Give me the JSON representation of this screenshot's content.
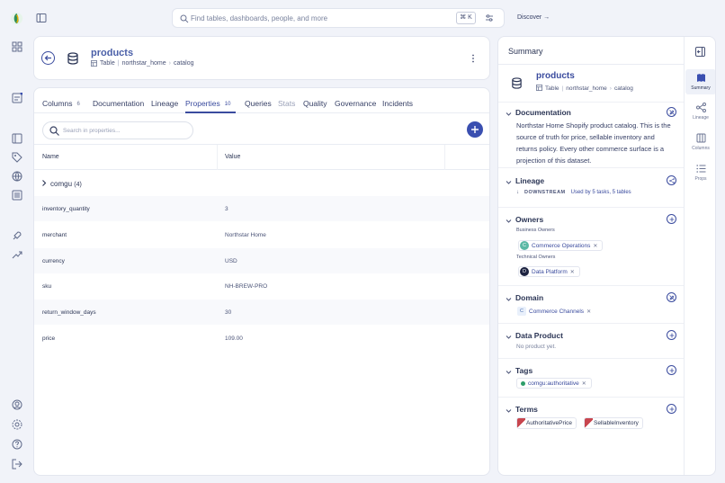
{
  "topbar": {
    "search_placeholder": "Find tables, dashboards, people, and more",
    "shortcut": "⌘ K",
    "discover_label": "Discover →"
  },
  "entity": {
    "name": "products",
    "type": "Table",
    "breadcrumb": [
      "northstar_home",
      "catalog"
    ]
  },
  "tabs": [
    {
      "label": "Columns",
      "count": "6"
    },
    {
      "label": "Documentation",
      "count": ""
    },
    {
      "label": "Lineage",
      "count": ""
    },
    {
      "label": "Properties",
      "count": "10"
    },
    {
      "label": "Queries",
      "count": ""
    },
    {
      "label": "Stats",
      "count": ""
    },
    {
      "label": "Quality",
      "count": ""
    },
    {
      "label": "Governance",
      "count": ""
    },
    {
      "label": "Incidents",
      "count": ""
    }
  ],
  "properties": {
    "search_placeholder": "Search in properties...",
    "col_name": "Name",
    "col_value": "Value",
    "group": {
      "label": "comgu",
      "count": "(4)"
    },
    "rows": [
      {
        "name": "inventory_quantity",
        "value": "3"
      },
      {
        "name": "merchant",
        "value": "Northstar Home"
      },
      {
        "name": "currency",
        "value": "USD"
      },
      {
        "name": "sku",
        "value": "NH-BREW-PRO"
      },
      {
        "name": "return_window_days",
        "value": "30"
      },
      {
        "name": "price",
        "value": "109.00"
      }
    ]
  },
  "summary": {
    "title": "Summary",
    "side_tabs": [
      "Summary",
      "Lineage",
      "Columns",
      "Props"
    ],
    "documentation": {
      "heading": "Documentation",
      "text": "Northstar Home Shopify product catalog. This is the source of truth for price, sellable inventory and returns policy. Every other commerce surface is a projection of this dataset."
    },
    "lineage": {
      "heading": "Lineage",
      "direction": "DOWNSTREAM",
      "used_by": "Used by 5 tasks, 5 tables"
    },
    "owners": {
      "heading": "Owners",
      "business_label": "Business Owners",
      "business": {
        "initial": "C",
        "name": "Commerce Operations"
      },
      "technical_label": "Technical Owners",
      "technical": {
        "initial": "D",
        "name": "Data Platform"
      }
    },
    "domain": {
      "heading": "Domain",
      "initial": "C",
      "name": "Commerce Channels"
    },
    "data_product": {
      "heading": "Data Product",
      "empty": "No product yet."
    },
    "tags": {
      "heading": "Tags",
      "items": [
        "comgu:authoritative"
      ]
    },
    "terms": {
      "heading": "Terms",
      "items": [
        "AuthoritativePrice",
        "SellableInventory"
      ]
    }
  },
  "colors": {
    "accent": "#3a4b9e",
    "tag_dot": "#2e9e6a",
    "term_flag": "#c8464f"
  }
}
